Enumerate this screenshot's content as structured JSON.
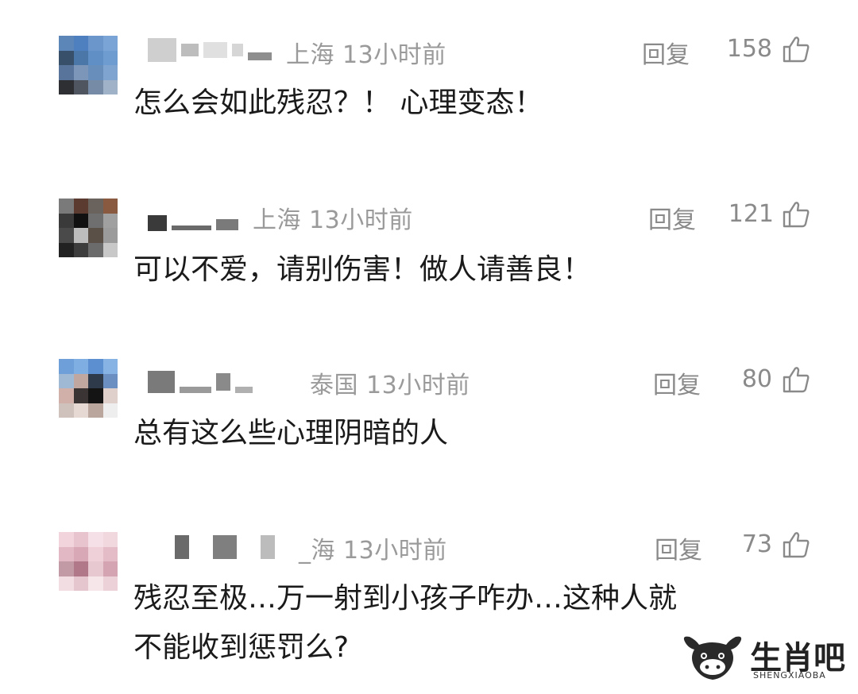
{
  "comments": [
    {
      "location_time": "上海 13小时前",
      "reply_label": "回复",
      "likes": "158",
      "text": "怎么会如此残忍？！ 心理变态！"
    },
    {
      "location_time": "上海 13小时前",
      "reply_label": "回复",
      "likes": "121",
      "text": "可以不爱，请别伤害！做人请善良！"
    },
    {
      "location_time": "泰国 13小时前",
      "reply_label": "回复",
      "likes": "80",
      "text": "总有这么些心理阴暗的人"
    },
    {
      "location_time": "_海 13小时前",
      "reply_label": "回复",
      "likes": "73",
      "text_line1": "残忍至极…万一射到小孩子咋办…这种人就",
      "text_line2": "不能收到惩罚么?"
    }
  ],
  "watermark": {
    "brand": "生肖吧",
    "sub": "SHENGXIAOBA"
  },
  "icons": {
    "like": "thumbs-up-icon",
    "logo": "ox-logo-icon"
  },
  "colors": {
    "meta": "#9a9a9a",
    "text": "#1a1a1a",
    "mask": "#c9c9c9"
  }
}
